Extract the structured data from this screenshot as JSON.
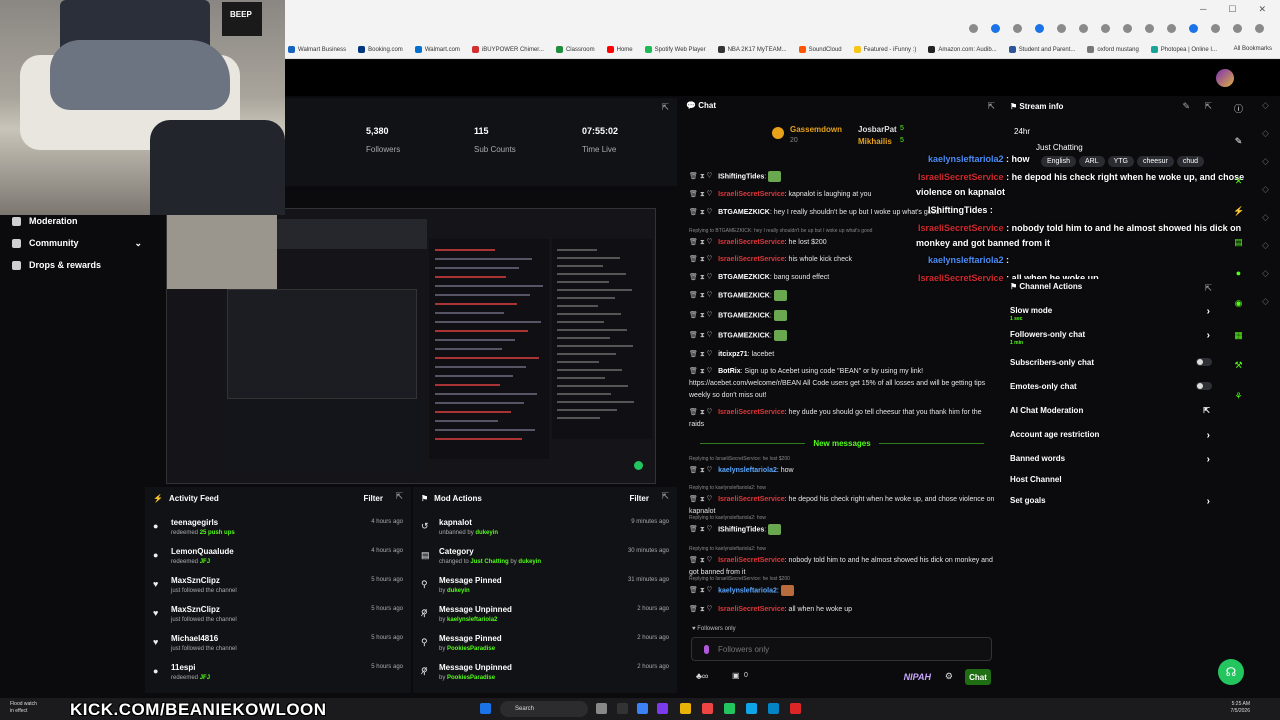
{
  "bookmarks": [
    "Walmart Business",
    "Booking.com",
    "Walmart.com",
    "iBUYPOWER Chimer...",
    "Classroom",
    "Home",
    "Spotify Web Player",
    "NBA 2K17 MyTEAM...",
    "SoundCloud",
    "Featured - iFunny :)",
    "Amazon.com: Audib...",
    "Student and Parent...",
    "oxford mustang",
    "Photopea | Online I..."
  ],
  "all_bookmarks": "All Bookmarks",
  "stats": [
    {
      "value": "5,380",
      "label": "Followers"
    },
    {
      "value": "115",
      "label": "Sub Counts"
    },
    {
      "value": "07:55:02",
      "label": "Time Live"
    }
  ],
  "nav": [
    {
      "label": "Moderation",
      "icon": "moderation-icon"
    },
    {
      "label": "Community",
      "icon": "community-icon"
    },
    {
      "label": "Drops & rewards",
      "icon": "drops-icon"
    }
  ],
  "activity": {
    "title": "Activity Feed",
    "filter": "Filter",
    "items": [
      {
        "name": "teenagegirls",
        "sub": "redeemed",
        "highlight": "25 push ups",
        "time": "4 hours ago",
        "icon": "redeem-icon"
      },
      {
        "name": "LemonQuaalude",
        "sub": "redeemed",
        "highlight": "JFJ",
        "time": "4 hours ago",
        "icon": "redeem-icon"
      },
      {
        "name": "MaxSznClipz",
        "sub": "just followed the channel",
        "highlight": "",
        "time": "5 hours ago",
        "icon": "heart-icon"
      },
      {
        "name": "MaxSznClipz",
        "sub": "just followed the channel",
        "highlight": "",
        "time": "5 hours ago",
        "icon": "heart-icon"
      },
      {
        "name": "Michael4816",
        "sub": "just followed the channel",
        "highlight": "",
        "time": "5 hours ago",
        "icon": "heart-icon"
      },
      {
        "name": "11espi",
        "sub": "redeemed",
        "highlight": "JFJ",
        "time": "5 hours ago",
        "icon": "redeem-icon"
      }
    ]
  },
  "mod": {
    "title": "Mod Actions",
    "filter": "Filter",
    "items": [
      {
        "name": "kapnalot",
        "sub": "unbanned by",
        "highlight": "dukeyin",
        "time": "9 minutes ago",
        "icon": "unban-icon"
      },
      {
        "name": "Category",
        "sub": "changed to",
        "highlight": "Just Chatting",
        "sub2": "by",
        "highlight2": "dukeyin",
        "time": "30 minutes ago",
        "icon": "category-icon"
      },
      {
        "name": "Message Pinned",
        "sub": "by",
        "highlight": "dukeyin",
        "time": "31 minutes ago",
        "icon": "pin-icon"
      },
      {
        "name": "Message Unpinned",
        "sub": "by",
        "highlight": "kaelynsleftariola2",
        "time": "2 hours ago",
        "icon": "unpin-icon"
      },
      {
        "name": "Message Pinned",
        "sub": "by",
        "highlight": "PookiesParadise",
        "time": "2 hours ago",
        "icon": "pin-icon"
      },
      {
        "name": "Message Unpinned",
        "sub": "by",
        "highlight": "PookiesParadise",
        "time": "2 hours ago",
        "icon": "unpin-icon"
      }
    ]
  },
  "chat": {
    "title": "Chat",
    "pinned": [
      {
        "name": "Gassemdown",
        "count": "20"
      },
      {
        "name": "JosbarPat",
        "count": "5"
      },
      {
        "name": "Mikhailis",
        "count": "5"
      }
    ],
    "messages": [
      {
        "user": "IShiftingTides",
        "color": "white",
        "text": "",
        "emote": true
      },
      {
        "user": "IsraeliSecretService",
        "color": "red",
        "text": "kapnalot is laughing at you"
      },
      {
        "user": "BTGAMEZKICK",
        "color": "white",
        "text": "hey I really shouldn't be up but I woke up what's good"
      },
      {
        "user": "IsraeliSecretService",
        "color": "red",
        "text": "he lost $200",
        "reply": "Replying to BTGAMEZKICK: hey I really shouldn't be up but I woke up what's good"
      },
      {
        "user": "IsraeliSecretService",
        "color": "red",
        "text": "his whole kick check"
      },
      {
        "user": "BTGAMEZKICK",
        "color": "white",
        "text": "bang sound effect"
      },
      {
        "user": "BTGAMEZKICK",
        "color": "white",
        "text": "",
        "emote": true
      },
      {
        "user": "BTGAMEZKICK",
        "color": "white",
        "text": "",
        "emote": true
      },
      {
        "user": "BTGAMEZKICK",
        "color": "white",
        "text": "",
        "emote": true
      },
      {
        "user": "itcixpz71",
        "color": "white",
        "text": "lacebet"
      },
      {
        "user": "BotRix",
        "color": "white",
        "text": "Sign up to Acebet using code \"BEAN\" or by using my link! https://acebet.com/welcome/r/BEAN All Code users get 15% of all losses and will be getting tips weekly so don't miss out!"
      },
      {
        "user": "IsraeliSecretService",
        "color": "red",
        "text": "hey dude you should go tell cheesur that you thank him for the raids"
      }
    ],
    "new_messages": "New messages",
    "new": [
      {
        "user": "kaelynsleftariola2",
        "color": "blue",
        "text": "how",
        "reply": "Replying to IsraeliSecretService: he lost $200"
      },
      {
        "user": "IsraeliSecretService",
        "color": "red",
        "text": "he depod his check right when he woke up, and chose violence on kapnalot",
        "reply": "Replying to kaelynsleftariola2: how"
      },
      {
        "user": "IShiftingTides",
        "color": "white",
        "text": "",
        "emote": true,
        "reply": "Replying to kaelynsleftariola2: how"
      },
      {
        "user": "IsraeliSecretService",
        "color": "red",
        "text": "nobody told him to and he almost showed his dick on monkey and got banned from it",
        "reply": "Replying to kaelynsleftariola2: how"
      },
      {
        "user": "kaelynsleftariola2",
        "color": "blue",
        "text": "",
        "emote": true,
        "reply": "Replying to IsraeliSecretService: he lost $200"
      },
      {
        "user": "IsraeliSecretService",
        "color": "red",
        "text": "all when he woke up"
      }
    ],
    "followers_only": "Followers only",
    "input_placeholder": "Followers only",
    "count": "0",
    "nipah": "NIPAH",
    "send": "Chat"
  },
  "stream_info": {
    "title": "Stream info",
    "stream_title": "24hr",
    "category": "Just Chatting",
    "tags": [
      "English",
      "ARL",
      "YTG",
      "cheesur",
      "chud"
    ]
  },
  "overlay": [
    {
      "user": "kaelynsleftariola2",
      "color": "blue",
      "text": "how"
    },
    {
      "user": "IsraeliSecretService",
      "color": "red",
      "text": "he depod his check right when he woke up, and chose"
    },
    {
      "user": "",
      "color": "white",
      "text": "violence on kapnalot"
    },
    {
      "user": "IShiftingTides",
      "color": "white",
      "text": ""
    },
    {
      "user": "IsraeliSecretService",
      "color": "red",
      "text": "nobody told him to and he almost showed his dick on"
    },
    {
      "user": "",
      "color": "white",
      "text": "monkey and got banned from it"
    },
    {
      "user": "kaelynsleftariola2",
      "color": "blue",
      "text": ""
    },
    {
      "user": "IsraeliSecretService",
      "color": "red",
      "text": "all when he woke up"
    }
  ],
  "channel_actions": {
    "title": "Channel Actions",
    "rows": [
      {
        "label": "Slow mode",
        "sub": "1 sec",
        "type": "chevron"
      },
      {
        "label": "Followers-only chat",
        "sub": "1 min",
        "type": "chevron"
      },
      {
        "label": "Subscribers-only chat",
        "sub": "",
        "type": "toggle"
      },
      {
        "label": "Emotes-only chat",
        "sub": "",
        "type": "toggle"
      },
      {
        "label": "AI Chat Moderation",
        "sub": "",
        "type": "external"
      },
      {
        "label": "Account age restriction",
        "sub": "",
        "type": "chevron"
      },
      {
        "label": "Banned words",
        "sub": "",
        "type": "chevron"
      },
      {
        "label": "Host Channel",
        "sub": "",
        "type": "none"
      },
      {
        "label": "Set goals",
        "sub": "",
        "type": "chevron"
      }
    ]
  },
  "taskbar": {
    "flood1": "Flood watch",
    "flood2": "in effect",
    "kick_url": "KICK.COM/BEANIEKOWLOON",
    "search": "Search",
    "time": "5:25 AM",
    "date": "7/5/2026"
  },
  "webcam": {
    "poster": "BEEP"
  }
}
